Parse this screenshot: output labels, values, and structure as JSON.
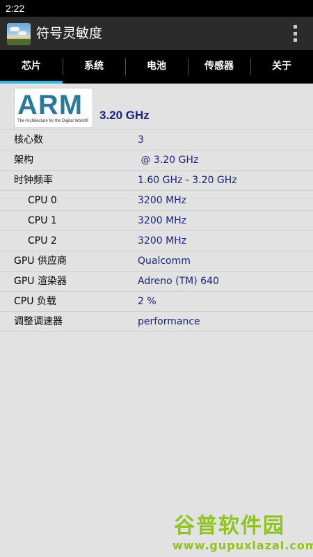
{
  "status_bar": {
    "time": "2:22"
  },
  "app_bar": {
    "title": "符号灵敏度",
    "icon": "app-landscape-icon",
    "menu_icon": "overflow-menu-icon"
  },
  "tabs": [
    {
      "label": "芯片",
      "active": true
    },
    {
      "label": "系统",
      "active": false
    },
    {
      "label": "电池",
      "active": false
    },
    {
      "label": "传感器",
      "active": false
    },
    {
      "label": "关于",
      "active": false
    }
  ],
  "cpu_header": {
    "logo_word": "ARM",
    "logo_tagline": "The Architecture for the Digital World®",
    "frequency": "3.20 GHz"
  },
  "rows": [
    {
      "label": "核心数",
      "value": "3"
    },
    {
      "label": "架构",
      "value": " @ 3.20 GHz"
    },
    {
      "label": "时钟频率",
      "value": "1.60 GHz - 3.20 GHz"
    },
    {
      "label": "CPU 0",
      "value": "3200 MHz"
    },
    {
      "label": "CPU 1",
      "value": "3200 MHz"
    },
    {
      "label": "CPU 2",
      "value": "3200 MHz"
    },
    {
      "label": "GPU 供应商",
      "value": "Qualcomm"
    },
    {
      "label": "GPU 渲染器",
      "value": "Adreno (TM) 640"
    },
    {
      "label": "CPU 负载",
      "value": "2 %"
    },
    {
      "label": "调整调速器",
      "value": "performance"
    }
  ],
  "watermark": {
    "main": "谷普软件园",
    "sub": "www.gupuxlazal.com"
  },
  "colors": {
    "accent": "#33b5e5",
    "value_text": "#1a237e",
    "background": "#e2e2e2",
    "app_bar": "#2b2b2b"
  }
}
